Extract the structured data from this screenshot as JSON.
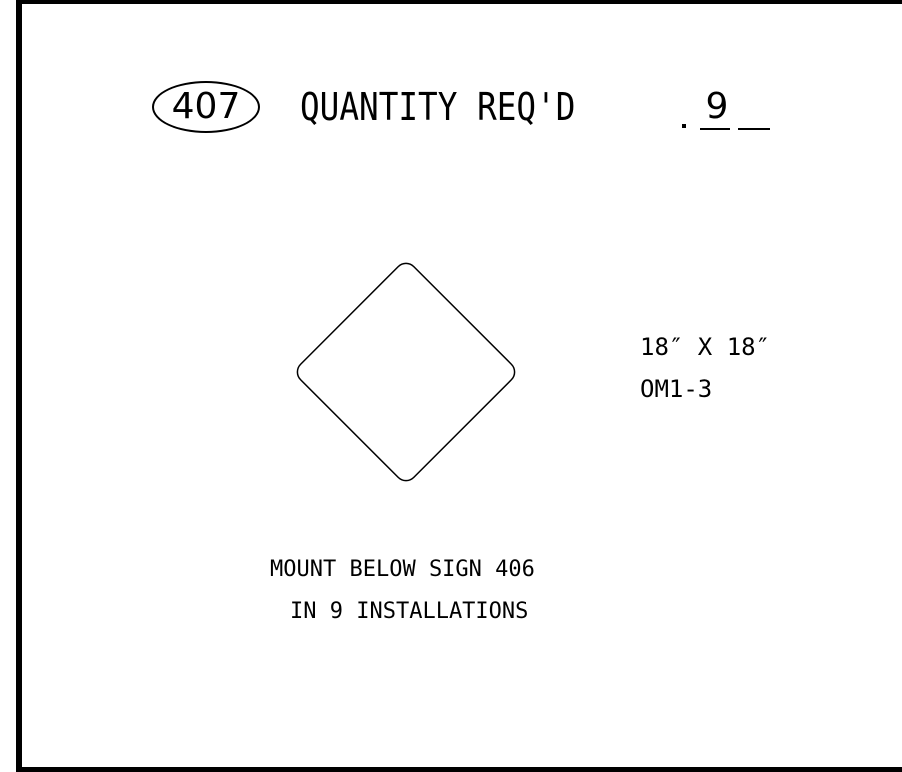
{
  "header": {
    "sign_number": "407",
    "quantity_label": "QUANTITY REQ'D",
    "quantity_value": "9"
  },
  "sign": {
    "size": "18″ X 18″",
    "code": "OM1-3"
  },
  "notes": {
    "line1": "MOUNT BELOW SIGN 406",
    "line2": "IN 9 INSTALLATIONS"
  }
}
